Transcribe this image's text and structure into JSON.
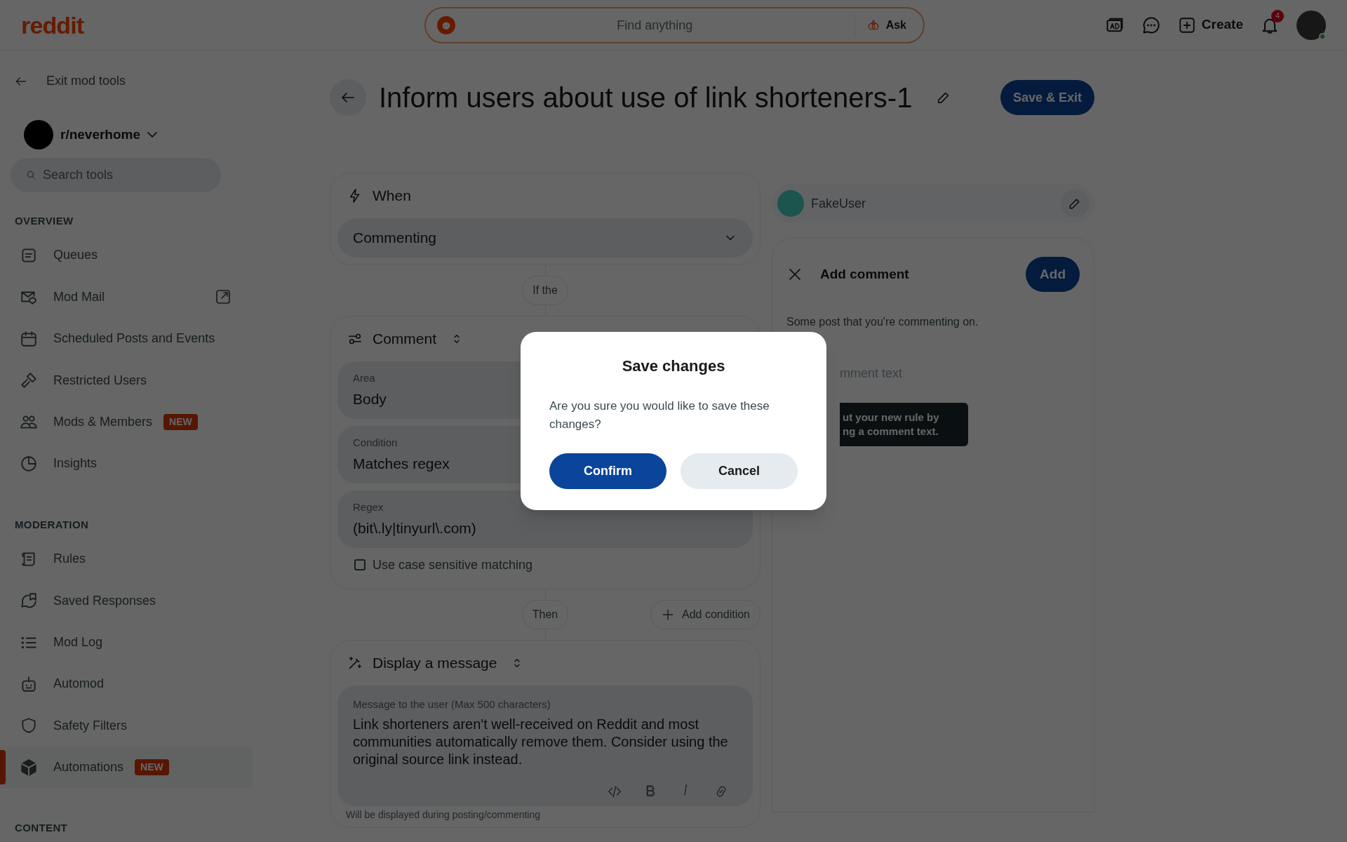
{
  "topbar": {
    "logo": "reddit",
    "search": {
      "placeholder": "Find anything"
    },
    "ask_button": "Ask",
    "create_button": "Create",
    "notifications_badge": "4"
  },
  "sidebar": {
    "exit_link": "Exit mod tools",
    "community": "r/neverhome",
    "search": {
      "placeholder": "Search tools"
    },
    "sections": [
      {
        "heading": "OVERVIEW",
        "items": [
          {
            "kind": "queue",
            "label": "Queues",
            "external": false,
            "selected": false
          },
          {
            "kind": "mail",
            "label": "Mod Mail",
            "external": true,
            "selected": false
          },
          {
            "kind": "calendar",
            "label": "Scheduled Posts and Events",
            "external": false,
            "selected": false
          },
          {
            "kind": "hammer",
            "label": "Restricted Users",
            "external": false,
            "selected": false
          },
          {
            "kind": "people",
            "label": "Mods & Members",
            "badge": "NEW",
            "external": false,
            "selected": false
          },
          {
            "kind": "chart",
            "label": "Insights",
            "external": false,
            "selected": false
          }
        ]
      },
      {
        "heading": "MODERATION",
        "items": [
          {
            "kind": "scroll",
            "label": "Rules",
            "external": false,
            "selected": false
          },
          {
            "kind": "bubble",
            "label": "Saved Responses",
            "external": false,
            "selected": false
          },
          {
            "kind": "list",
            "label": "Mod Log",
            "external": false,
            "selected": false
          },
          {
            "kind": "robot",
            "label": "Automod",
            "external": false,
            "selected": false
          },
          {
            "kind": "shield",
            "label": "Safety Filters",
            "external": false,
            "selected": false
          },
          {
            "kind": "cube",
            "label": "Automations",
            "badge": "NEW",
            "external": false,
            "selected": true
          }
        ]
      },
      {
        "heading": "CONTENT"
      }
    ]
  },
  "editor": {
    "title": "Inform users about use of link shorteners-1",
    "save_button": "Save & Exit",
    "when": {
      "heading": "When",
      "select": "Commenting"
    },
    "if_pill": "If the",
    "condition": {
      "heading": "Comment",
      "fields": [
        {
          "label": "Area",
          "value": "Body"
        },
        {
          "label": "Condition",
          "value": "Matches regex"
        },
        {
          "label": "Regex",
          "value": "(bit\\.ly|tinyurl\\.com)"
        }
      ],
      "checkbox": {
        "label": "Use case sensitive matching",
        "checked": false
      }
    },
    "then_pill": "Then",
    "add_condition": "Add condition",
    "action": {
      "heading": "Display a message",
      "message_label": "Message to the user (Max 500 characters)",
      "message": "Link shorteners aren't well-received on Reddit and most communities automatically remove them. Consider using the original source link instead.",
      "hint": "Will be displayed during posting/commenting"
    }
  },
  "preview": {
    "user": "FakeUser",
    "panel_title": "Add comment",
    "add_button": "Add",
    "post_text": "Some post that you're commenting on.",
    "placeholder": "mment text",
    "tooltip": [
      "ut your new rule by",
      "ng a comment text."
    ]
  },
  "modal": {
    "title": "Save changes",
    "message": "Are you sure you would like to save these changes?",
    "confirm": "Confirm",
    "cancel": "Cancel"
  }
}
